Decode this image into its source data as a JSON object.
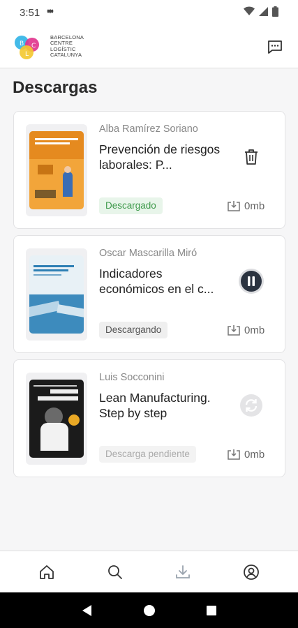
{
  "status_bar": {
    "time": "3:51"
  },
  "header": {
    "logo_lines": [
      "BARCELONA",
      "CENTRE",
      "LOGÍSTIC",
      "CATALUNYA"
    ],
    "logo_letters": [
      "B",
      "C",
      "L"
    ]
  },
  "page_title": "Descargas",
  "downloads": [
    {
      "author": "Alba Ramírez Soriano",
      "title": "Prevención de riesgos laborales: P...",
      "status": "Descargado",
      "size": "0mb",
      "action_icon": "trash-icon"
    },
    {
      "author": "Oscar Mascarilla Miró",
      "title": "Indicadores económicos en el c...",
      "status": "Descargando",
      "size": "0mb",
      "action_icon": "pause-icon"
    },
    {
      "author": "Luis Socconini",
      "title": "Lean Manufacturing. Step by step",
      "status": "Descarga pendiente",
      "size": "0mb",
      "action_icon": "sync-icon"
    }
  ],
  "bottom_nav": [
    "home-icon",
    "search-icon",
    "download-icon",
    "profile-icon"
  ],
  "colors": {
    "accent_green": "#3f9a4c",
    "pause_button": "#2b3340"
  }
}
